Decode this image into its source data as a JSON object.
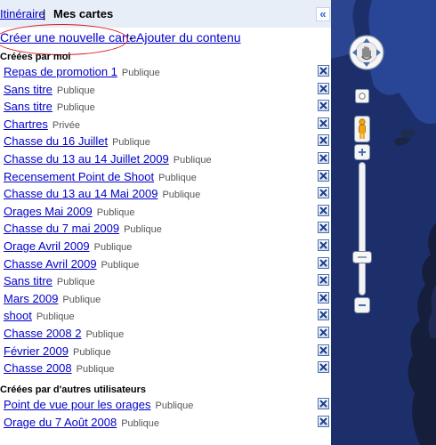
{
  "header": {
    "tab_itineraire": "Itinéraire",
    "tab_separator": "|",
    "tab_mes_cartes": "Mes cartes",
    "collapse_glyph": "«"
  },
  "actions": {
    "create_map": "Créer une nouvelle carte",
    "separator": "-",
    "add_content": "Ajouter du contenu"
  },
  "sections": {
    "mine_title": "Créées par moi",
    "others_title": "Créées par d'autres utilisateurs"
  },
  "maps_mine": [
    {
      "name": "Repas de promotion 1",
      "status": "Publique"
    },
    {
      "name": "Sans titre",
      "status": "Publique"
    },
    {
      "name": "Sans titre",
      "status": "Publique"
    },
    {
      "name": "Chartres",
      "status": "Privée"
    },
    {
      "name": "Chasse du 16 Juillet",
      "status": "Publique"
    },
    {
      "name": "Chasse du 13 au 14 Juillet 2009",
      "status": "Publique"
    },
    {
      "name": "Recensement Point de Shoot",
      "status": "Publique"
    },
    {
      "name": "Chasse du 13 au 14 Mai 2009",
      "status": "Publique"
    },
    {
      "name": "Orages Mai 2009",
      "status": "Publique"
    },
    {
      "name": "Chasse du 7 mai 2009",
      "status": "Publique"
    },
    {
      "name": "Orage Avril 2009",
      "status": "Publique"
    },
    {
      "name": "Chasse Avril 2009",
      "status": "Publique"
    },
    {
      "name": "Sans titre",
      "status": "Publique"
    },
    {
      "name": "Mars 2009",
      "status": "Publique"
    },
    {
      "name": "shoot",
      "status": "Publique"
    },
    {
      "name": "Chasse 2008 2",
      "status": "Publique"
    },
    {
      "name": "Février 2009",
      "status": "Publique"
    },
    {
      "name": "Chasse 2008",
      "status": "Publique"
    }
  ],
  "maps_others": [
    {
      "name": "Point de vue pour les orages",
      "status": "Publique"
    },
    {
      "name": "Orage du 7 Août 2008",
      "status": "Publique"
    }
  ],
  "colors": {
    "link": "#0000cc",
    "header_bg": "#e8eef7",
    "ocean": "#1e2f66",
    "annotation": "#d9151e"
  },
  "icons": {
    "delete": "delete-x-icon",
    "pan": "pan-hand-icon",
    "streetview": "pegman-icon"
  }
}
